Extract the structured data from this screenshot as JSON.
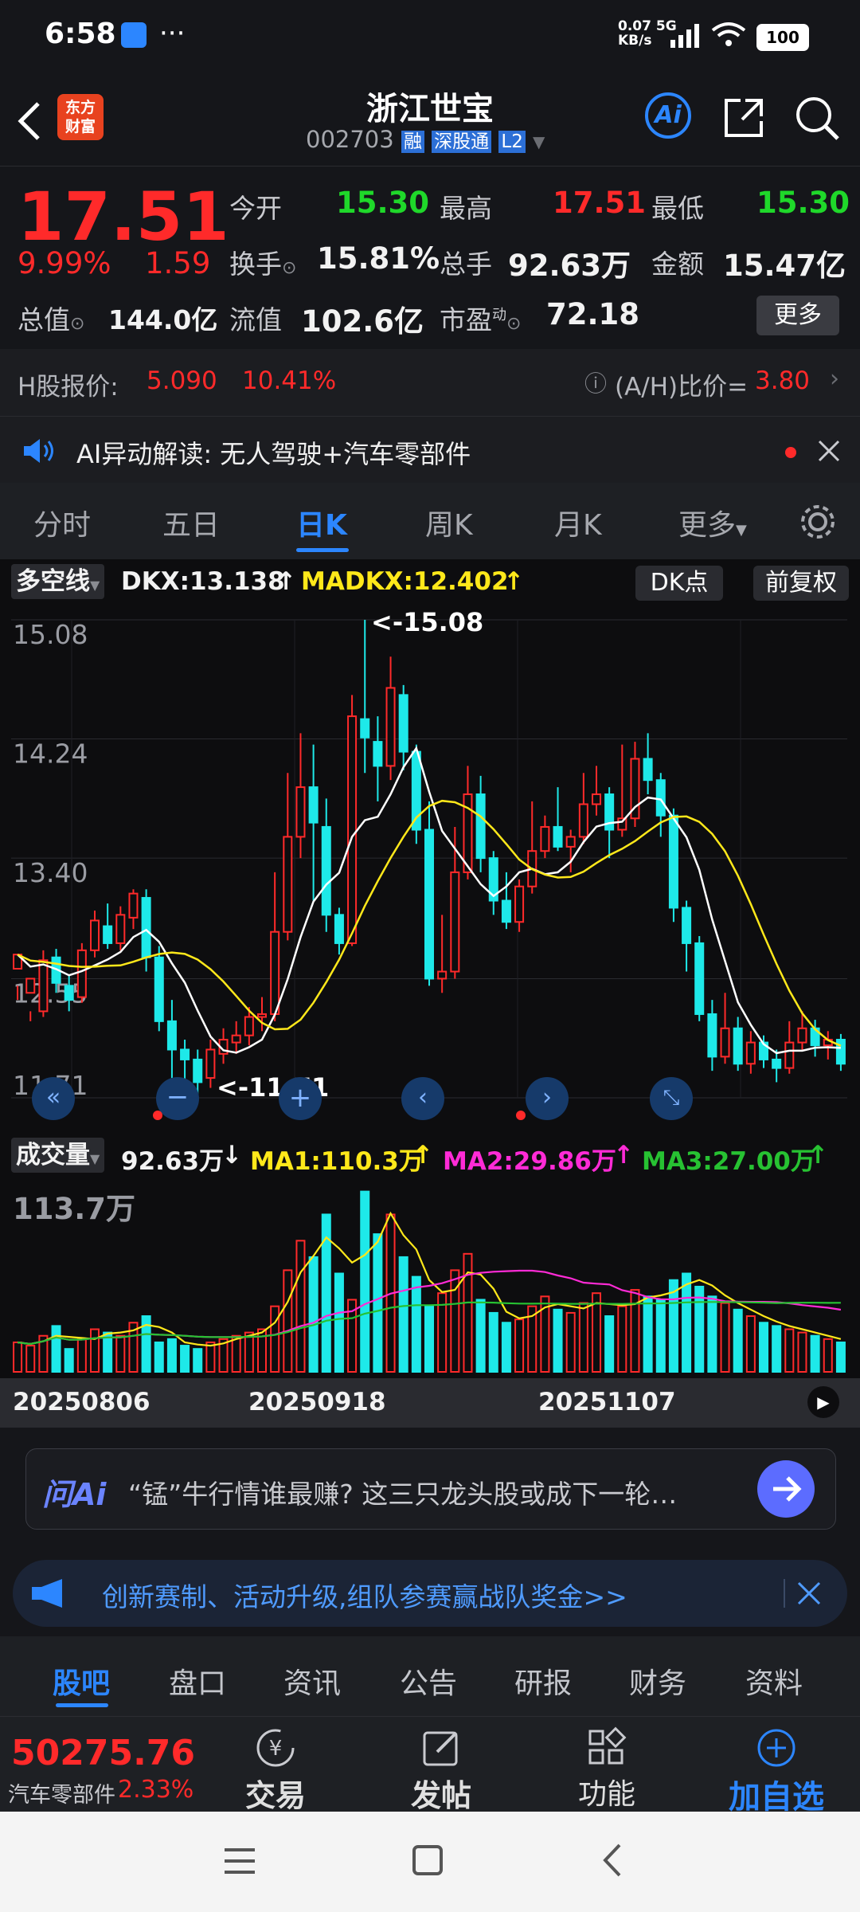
{
  "status": {
    "time": "6:58",
    "net_speed": "0.07",
    "net_unit": "KB/s",
    "net_type": "5G",
    "battery": "100"
  },
  "header": {
    "logo_line1": "东方",
    "logo_line2": "财富",
    "title": "浙江世宝",
    "code": "002703",
    "tag_rong": "融",
    "tag_sgt": "深股通",
    "tag_l2": "L2",
    "ai_label": "Ai"
  },
  "quote": {
    "price": "17.51",
    "pct": "9.99%",
    "chg": "1.59",
    "open_label": "今开",
    "open": "15.30",
    "high_label": "最高",
    "high": "17.51",
    "low_label": "最低",
    "low": "15.30",
    "turnover_label": "换手",
    "turnover": "15.81%",
    "vol_label": "总手",
    "vol": "92.63万",
    "amount_label": "金额",
    "amount": "15.47亿",
    "mktcap_label": "总值",
    "mktcap": "144.0亿",
    "float_label": "流值",
    "float": "102.6亿",
    "pe_label": "市盈",
    "pe_sup": "动",
    "pe": "72.18",
    "more": "更多"
  },
  "hshare": {
    "label": "H股报价:",
    "price": "5.090",
    "pct": "10.41%",
    "ratio_label": "(A/H)比价=",
    "ratio": "3.80"
  },
  "ai_notice": {
    "text": "AI异动解读: 无人驾驶+汽车零部件"
  },
  "tabs": [
    "分时",
    "五日",
    "日K",
    "周K",
    "月K",
    "更多"
  ],
  "chart_header": {
    "indicator": "多空线",
    "dkx": "DKX:13.138",
    "madkx": "MADKX:12.402",
    "dk_btn": "DK点",
    "fq_btn": "前复权"
  },
  "chart_data": [
    {
      "type": "candlestick",
      "y_ticks": [
        "15.08",
        "14.24",
        "13.40",
        "12.55",
        "11.71"
      ],
      "ylim": [
        11.71,
        15.08
      ],
      "annotations": [
        "<-15.08",
        "<-11.71"
      ],
      "x_ticks": [
        "20250806",
        "20250918",
        "20251107"
      ],
      "series_colors": {
        "up": "#ff2a2a",
        "down": "#1ee9e9",
        "dkx": "#ffffff",
        "madkx": "#ffe81a"
      },
      "candles": [
        [
          12.62,
          12.72,
          12.5,
          12.4
        ],
        [
          12.45,
          12.55,
          12.32,
          12.25
        ],
        [
          12.32,
          12.68,
          12.75,
          12.28
        ],
        [
          12.7,
          12.52,
          12.76,
          12.45
        ],
        [
          12.5,
          12.4,
          12.58,
          12.32
        ],
        [
          12.42,
          12.75,
          12.8,
          12.38
        ],
        [
          12.75,
          12.96,
          13.03,
          12.7
        ],
        [
          12.92,
          12.8,
          13.08,
          12.76
        ],
        [
          12.8,
          13.0,
          13.06,
          12.75
        ],
        [
          12.98,
          13.15,
          13.18,
          12.9
        ],
        [
          13.12,
          12.7,
          13.18,
          12.6
        ],
        [
          12.7,
          12.25,
          12.78,
          12.18
        ],
        [
          12.25,
          12.05,
          12.4,
          11.85
        ],
        [
          12.05,
          11.98,
          12.12,
          11.8
        ],
        [
          11.98,
          11.82,
          12.05,
          11.71
        ],
        [
          11.85,
          12.05,
          12.12,
          11.78
        ],
        [
          12.02,
          12.12,
          12.2,
          11.95
        ],
        [
          12.1,
          12.15,
          12.25,
          12.02
        ],
        [
          12.15,
          12.28,
          12.35,
          12.08
        ],
        [
          12.28,
          12.3,
          12.42,
          12.18
        ],
        [
          12.3,
          12.88,
          13.3,
          12.25
        ],
        [
          12.88,
          13.55,
          14.0,
          12.82
        ],
        [
          13.55,
          13.9,
          14.28,
          13.4
        ],
        [
          13.9,
          13.65,
          14.2,
          13.1
        ],
        [
          13.62,
          13.0,
          13.82,
          12.88
        ],
        [
          13.0,
          12.8,
          13.05,
          12.72
        ],
        [
          12.8,
          14.4,
          14.55,
          12.78
        ],
        [
          14.38,
          14.25,
          15.08,
          14.0
        ],
        [
          14.22,
          14.05,
          14.4,
          13.8
        ],
        [
          14.05,
          14.6,
          14.82,
          13.95
        ],
        [
          14.55,
          14.15,
          14.62,
          14.02
        ],
        [
          14.15,
          13.6,
          14.2,
          13.5
        ],
        [
          13.6,
          12.55,
          13.8,
          12.5
        ],
        [
          12.55,
          12.6,
          13.0,
          12.45
        ],
        [
          12.6,
          13.3,
          13.62,
          12.55
        ],
        [
          13.3,
          13.85,
          14.05,
          13.25
        ],
        [
          13.85,
          13.4,
          13.98,
          13.3
        ],
        [
          13.4,
          13.1,
          13.45,
          13.0
        ],
        [
          13.1,
          12.95,
          13.3,
          12.9
        ],
        [
          12.95,
          13.2,
          13.25,
          12.88
        ],
        [
          13.2,
          13.45,
          13.8,
          13.15
        ],
        [
          13.45,
          13.62,
          13.7,
          13.4
        ],
        [
          13.62,
          13.48,
          13.9,
          13.45
        ],
        [
          13.48,
          13.55,
          13.6,
          13.3
        ],
        [
          13.55,
          13.78,
          14.0,
          13.5
        ],
        [
          13.78,
          13.85,
          14.05,
          13.7
        ],
        [
          13.85,
          13.6,
          13.9,
          13.4
        ],
        [
          13.6,
          13.68,
          14.2,
          13.55
        ],
        [
          13.68,
          14.1,
          14.22,
          13.62
        ],
        [
          14.1,
          13.95,
          14.28,
          13.85
        ],
        [
          13.95,
          13.7,
          14.0,
          13.55
        ],
        [
          13.7,
          13.05,
          13.75,
          12.95
        ],
        [
          13.05,
          12.8,
          13.1,
          12.6
        ],
        [
          12.8,
          12.3,
          12.85,
          12.25
        ],
        [
          12.3,
          12.0,
          12.4,
          11.9
        ],
        [
          12.0,
          12.2,
          12.45,
          11.95
        ],
        [
          12.2,
          11.95,
          12.28,
          11.9
        ],
        [
          11.95,
          12.1,
          12.18,
          11.88
        ],
        [
          12.1,
          11.98,
          12.15,
          11.92
        ],
        [
          11.98,
          11.92,
          12.05,
          11.82
        ],
        [
          11.92,
          12.1,
          12.25,
          11.88
        ],
        [
          12.1,
          12.2,
          12.32,
          12.05
        ],
        [
          12.2,
          12.08,
          12.26,
          12.0
        ],
        [
          12.08,
          12.12,
          12.18,
          11.98
        ],
        [
          12.12,
          11.95,
          12.16,
          11.9
        ]
      ]
    },
    {
      "type": "bar",
      "indicator": "成交量",
      "vol": "92.63万",
      "ma1": "MA1:110.3万",
      "ma2": "MA2:29.86万",
      "ma3": "MA3:27.00万",
      "max_label": "113.7万",
      "ylim": [
        0,
        113.7
      ],
      "values": [
        18,
        16,
        22,
        28,
        14,
        20,
        26,
        24,
        22,
        30,
        34,
        18,
        20,
        16,
        14,
        18,
        20,
        22,
        24,
        26,
        40,
        62,
        80,
        70,
        96,
        60,
        44,
        110,
        84,
        96,
        70,
        58,
        40,
        48,
        62,
        72,
        44,
        36,
        30,
        32,
        40,
        46,
        38,
        36,
        42,
        48,
        34,
        40,
        50,
        46,
        44,
        56,
        60,
        52,
        46,
        42,
        38,
        34,
        30,
        28,
        26,
        24,
        22,
        20,
        18
      ]
    }
  ],
  "ask_ai": {
    "brand": "问Ai",
    "text": "“锰”牛行情谁最赚? 这三只龙头股或成下一轮…"
  },
  "banner": {
    "text": "创新赛制、活动升级,组队参赛赢战队奖金>>"
  },
  "bottom_tabs": [
    "股吧",
    "盘口",
    "资讯",
    "公告",
    "研报",
    "财务",
    "资料"
  ],
  "index": {
    "value": "50275.76",
    "name": "汽车零部件",
    "pct": "2.33%"
  },
  "actions": [
    {
      "label": "交易",
      "icon": "yen-icon"
    },
    {
      "label": "发帖",
      "icon": "edit-icon"
    },
    {
      "label": "功能",
      "icon": "grid-icon"
    },
    {
      "label": "加自选",
      "icon": "plus-circle-icon"
    }
  ]
}
